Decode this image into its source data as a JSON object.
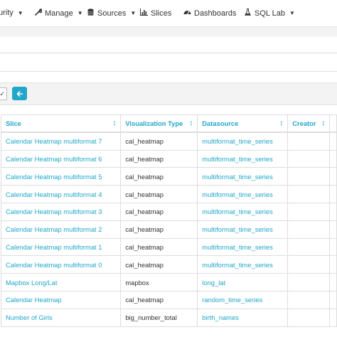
{
  "nav": {
    "items": [
      {
        "label": "urity",
        "icon": "",
        "has_caret": true
      },
      {
        "label": "Manage",
        "icon": "wrench-icon",
        "has_caret": true
      },
      {
        "label": "Sources",
        "icon": "database-icon",
        "has_caret": true
      },
      {
        "label": "Slices",
        "icon": "bar-chart-icon",
        "has_caret": false
      },
      {
        "label": "Dashboards",
        "icon": "dashboard-icon",
        "has_caret": false
      },
      {
        "label": "SQL Lab",
        "icon": "flask-icon",
        "has_caret": true
      }
    ]
  },
  "filter": {
    "select_stub": "✓",
    "back_icon": "arrow-left-icon"
  },
  "table": {
    "headers": [
      "Slice",
      "Visualization Type",
      "Datasource",
      "Creator"
    ],
    "rows": [
      [
        "Calendar Heatmap multiformat 7",
        "cal_heatmap",
        "multiformat_time_series",
        ""
      ],
      [
        "Calendar Heatmap multiformat 6",
        "cal_heatmap",
        "multiformat_time_series",
        ""
      ],
      [
        "Calendar Heatmap multiformat 5",
        "cal_heatmap",
        "multiformat_time_series",
        ""
      ],
      [
        "Calendar Heatmap multiformat 4",
        "cal_heatmap",
        "multiformat_time_series",
        ""
      ],
      [
        "Calendar Heatmap multiformat 3",
        "cal_heatmap",
        "multiformat_time_series",
        ""
      ],
      [
        "Calendar Heatmap multiformat 2",
        "cal_heatmap",
        "multiformat_time_series",
        ""
      ],
      [
        "Calendar Heatmap multiformat 1",
        "cal_heatmap",
        "multiformat_time_series",
        ""
      ],
      [
        "Calendar Heatmap multiformat 0",
        "cal_heatmap",
        "multiformat_time_series",
        ""
      ],
      [
        "Mapbox Long/Lat",
        "mapbox",
        "long_lat",
        ""
      ],
      [
        "Calendar Heatmap",
        "cal_heatmap",
        "random_time_series",
        ""
      ],
      [
        "Number of Girls",
        "big_number_total",
        "birth_names",
        ""
      ]
    ]
  },
  "colors": {
    "accent": "#20a7c9"
  }
}
